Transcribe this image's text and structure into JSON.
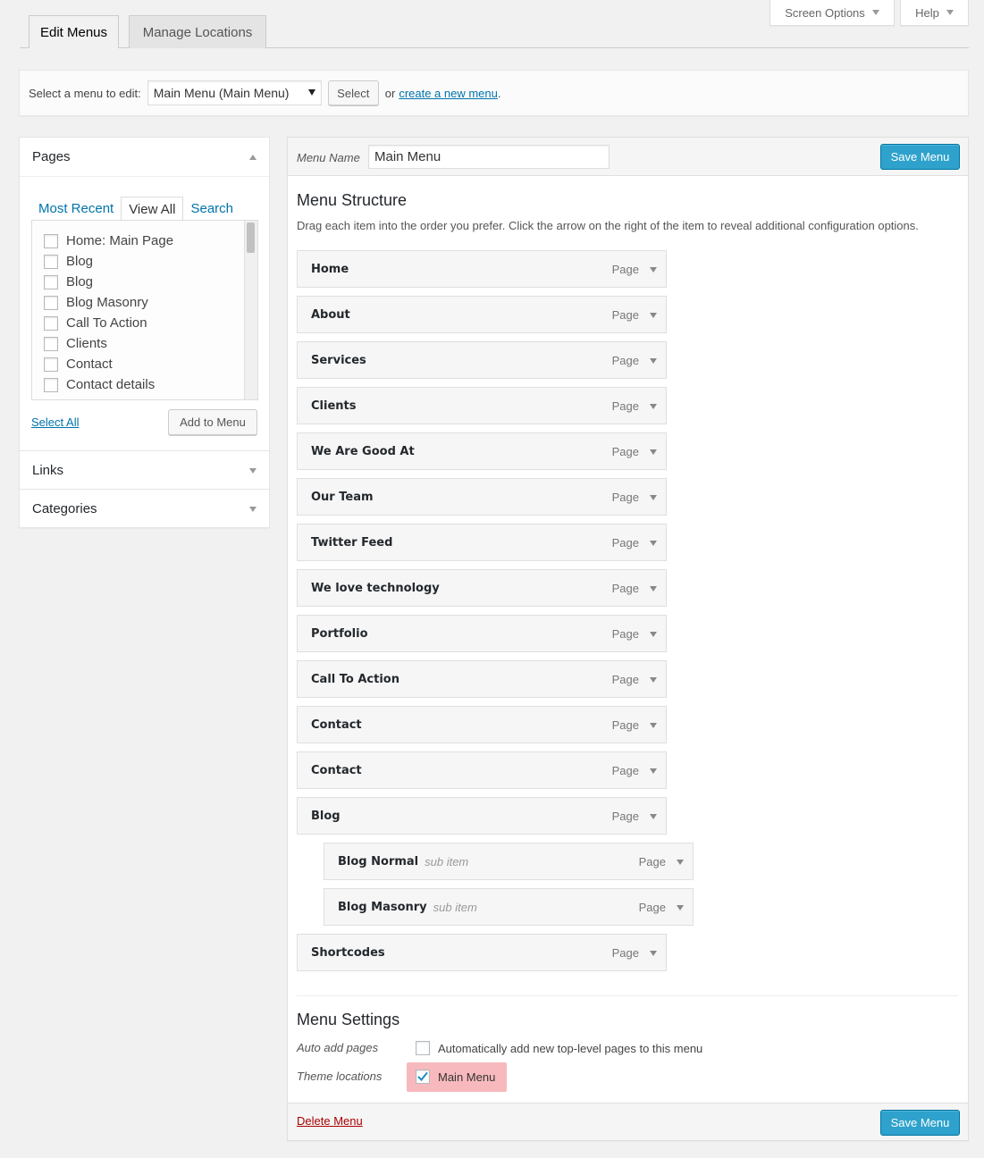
{
  "screen_meta": {
    "screen_options": "Screen Options",
    "help": "Help"
  },
  "tabs": {
    "edit_menus": "Edit Menus",
    "manage_locations": "Manage Locations"
  },
  "manage": {
    "select_label": "Select a menu to edit:",
    "selected_menu": "Main Menu (Main Menu)",
    "select_button": "Select",
    "or_text": "or",
    "create_link": "create a new menu",
    "period": "."
  },
  "sidebar": {
    "pages": {
      "title": "Pages",
      "tabs": [
        "Most Recent",
        "View All",
        "Search"
      ],
      "items": [
        "Home: Main Page",
        "Blog",
        "Blog",
        "Blog Masonry",
        "Call To Action",
        "Clients",
        "Contact",
        "Contact details"
      ],
      "select_all": "Select All",
      "add_button": "Add to Menu"
    },
    "links_title": "Links",
    "categories_title": "Categories"
  },
  "menu": {
    "name_label": "Menu Name",
    "name_value": "Main Menu",
    "save_button": "Save Menu",
    "structure_title": "Menu Structure",
    "structure_help": "Drag each item into the order you prefer. Click the arrow on the right of the item to reveal additional configuration options.",
    "items": [
      {
        "title": "Home",
        "type": "Page"
      },
      {
        "title": "About",
        "type": "Page"
      },
      {
        "title": "Services",
        "type": "Page"
      },
      {
        "title": "Clients",
        "type": "Page"
      },
      {
        "title": "We Are Good At",
        "type": "Page"
      },
      {
        "title": "Our Team",
        "type": "Page"
      },
      {
        "title": "Twitter Feed",
        "type": "Page"
      },
      {
        "title": "We love technology",
        "type": "Page"
      },
      {
        "title": "Portfolio",
        "type": "Page"
      },
      {
        "title": "Call To Action",
        "type": "Page"
      },
      {
        "title": "Contact",
        "type": "Page"
      },
      {
        "title": "Contact",
        "type": "Page"
      },
      {
        "title": "Blog",
        "type": "Page"
      },
      {
        "title": "Blog Normal",
        "type": "Page",
        "sub": "sub item"
      },
      {
        "title": "Blog Masonry",
        "type": "Page",
        "sub": "sub item"
      },
      {
        "title": "Shortcodes",
        "type": "Page"
      }
    ],
    "settings_title": "Menu Settings",
    "auto_add_label": "Auto add pages",
    "auto_add_text": "Automatically add new top-level pages to this menu",
    "auto_add_checked": false,
    "theme_locations_label": "Theme locations",
    "location_main": "Main Menu",
    "location_main_checked": true,
    "delete_link": "Delete Menu"
  },
  "colors": {
    "primary": "#2ea2cc",
    "link": "#0073aa",
    "delete": "#a00",
    "highlight": "#f7b9bd"
  }
}
